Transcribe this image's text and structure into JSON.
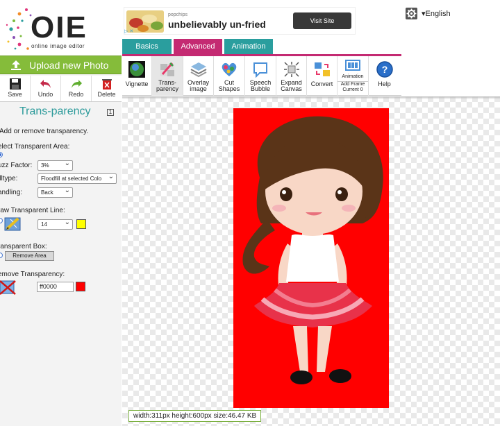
{
  "app": {
    "logo_text": "OIE",
    "tagline": "online image editor"
  },
  "upload": {
    "label": "Upload new Photo",
    "icon": "upload-icon"
  },
  "file_actions": [
    {
      "label": "Save",
      "icon": "save-icon"
    },
    {
      "label": "Undo",
      "icon": "undo-icon"
    },
    {
      "label": "Redo",
      "icon": "redo-icon"
    },
    {
      "label": "Delete",
      "icon": "delete-icon"
    }
  ],
  "panel": {
    "title": "Trans-parency",
    "collapse": "1",
    "intro": "Add or remove transparency.",
    "select_area_label": "elect Transparent Area:",
    "fuzz_label": "uzz Factor:",
    "fuzz_value": "3%",
    "filltype_label": "illtype:",
    "filltype_value": "Floodfill at selected Colo",
    "handling_label": "andling:",
    "handling_value": "Back",
    "draw_line_label": "raw Transparent Line:",
    "line_width_value": "14",
    "line_color": "#ffff00",
    "box_label": "ransparent Box:",
    "remove_area_button": "Remove Area",
    "remove_transparency_label": "emove Transparency:",
    "remove_color_value": "ff0000",
    "remove_color": "#ff0000"
  },
  "ad": {
    "brand": "popchips",
    "headline": "unbelievably un-fried",
    "cta": "Visit Site",
    "choices": "▷ ✕"
  },
  "topbar": {
    "language": "▾English"
  },
  "tabs": [
    {
      "label": "Basics",
      "color": "#2a9e9e"
    },
    {
      "label": "Advanced",
      "color": "#c42a72"
    },
    {
      "label": "Animation",
      "color": "#2a9e9e"
    }
  ],
  "tools": [
    {
      "label": "Vignette",
      "icon": "vignette-icon"
    },
    {
      "label": "Trans-parency",
      "line1": "Trans-",
      "line2": "parency",
      "icon": "transparency-icon"
    },
    {
      "label": "Overlay image",
      "line1": "Overlay",
      "line2": "image",
      "icon": "overlay-icon"
    },
    {
      "label": "Cut Shapes",
      "line1": "Cut",
      "line2": "Shapes",
      "icon": "cut-shapes-icon"
    },
    {
      "label": "Speech Bubble",
      "line1": "Speech",
      "line2": "Bubble",
      "icon": "speech-bubble-icon"
    },
    {
      "label": "Expand Canvas",
      "line1": "Expand",
      "line2": "Canvas",
      "icon": "expand-canvas-icon"
    },
    {
      "label": "Convert",
      "icon": "convert-icon"
    },
    {
      "label": "Animation",
      "sub1": "Add Frame",
      "sub2": "Current 0",
      "icon": "animation-icon"
    },
    {
      "label": "Help",
      "icon": "help-icon"
    }
  ],
  "canvas": {
    "background_color": "#ff0000",
    "info": "width:311px  height:600px  size:46.47 KB"
  }
}
